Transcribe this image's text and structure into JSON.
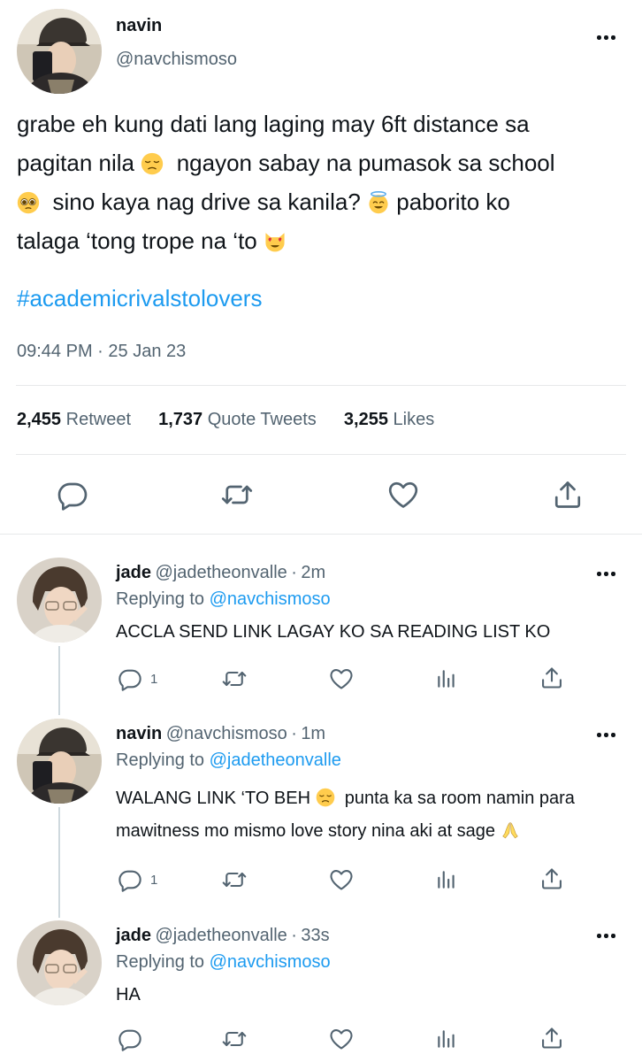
{
  "tweet": {
    "name": "navin",
    "handle": "@navchismoso",
    "text_lines": [
      "grabe eh kung dati lang laging may 6ft distance sa",
      "pagitan nila",
      "ngayon sabay na pumasok sa school",
      "sino kaya nag drive sa kanila?",
      "paborito ko",
      "talaga ‘tong trope na ‘to"
    ],
    "hashtag": "#academicrivalstolovers",
    "time": "09:44 PM",
    "date_sep": "·",
    "date": "25 Jan 23",
    "stats": {
      "retweets_count": "2,455",
      "retweets_label": "Retweet",
      "quotes_count": "1,737",
      "quotes_label": "Quote Tweets",
      "likes_count": "3,255",
      "likes_label": "Likes"
    }
  },
  "replies": [
    {
      "name": "jade",
      "handle": "@jadetheonvalle",
      "sep": "·",
      "time": "2m",
      "replying_label": "Replying to",
      "replying_to": "@navchismoso",
      "text_lines": [
        "ACCLA SEND LINK LAGAY KO SA READING LIST KO"
      ],
      "reply_count": "1"
    },
    {
      "name": "navin",
      "handle": "@navchismoso",
      "sep": "·",
      "time": "1m",
      "replying_label": "Replying to",
      "replying_to": "@jadetheonvalle",
      "text_lines": [
        "WALANG LINK ‘TO BEH",
        "punta ka sa room namin para",
        "mawitness mo mismo love story nina aki at sage"
      ],
      "reply_count": "1"
    },
    {
      "name": "jade",
      "handle": "@jadetheonvalle",
      "sep": "·",
      "time": "33s",
      "replying_label": "Replying to",
      "replying_to": "@navchismoso",
      "text_lines": [
        "HA"
      ],
      "reply_count": ""
    }
  ],
  "icons": {
    "more": "more-dots-icon",
    "reply": "reply-icon",
    "retweet": "retweet-icon",
    "like": "heart-icon",
    "share": "share-icon",
    "views": "views-icon",
    "emoji_pensive": "pensive-face-emoji",
    "emoji_pleading": "pleading-face-emoji",
    "emoji_halo": "halo-face-emoji",
    "emoji_heart_cat": "heart-eyes-cat-emoji",
    "emoji_pray": "folded-hands-emoji"
  },
  "colors": {
    "text": "#0f1419",
    "muted": "#536471",
    "link": "#1d9bf0",
    "divider": "#e7e9ea"
  }
}
